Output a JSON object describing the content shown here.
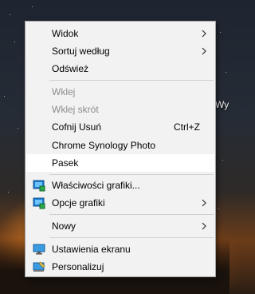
{
  "desktop": {
    "edge_text": "Wy"
  },
  "menu": {
    "items": [
      {
        "label": "Widok",
        "submenu": true
      },
      {
        "label": "Sortuj według",
        "submenu": true
      },
      {
        "label": "Odśwież"
      },
      {
        "label": "Wklej",
        "disabled": true
      },
      {
        "label": "Wklej skrót",
        "disabled": true
      },
      {
        "label": "Cofnij Usuń",
        "shortcut": "Ctrl+Z"
      },
      {
        "label": "Chrome Synology Photo"
      },
      {
        "label": "Pasek",
        "hover": true
      },
      {
        "label": "Właściwości grafiki...",
        "icon": "intel-graphics-icon"
      },
      {
        "label": "Opcje grafiki",
        "icon": "intel-graphics-icon",
        "submenu": true
      },
      {
        "label": "Nowy",
        "submenu": true
      },
      {
        "label": "Ustawienia ekranu",
        "icon": "display-icon"
      },
      {
        "label": "Personalizuj",
        "icon": "personalize-icon"
      }
    ]
  }
}
